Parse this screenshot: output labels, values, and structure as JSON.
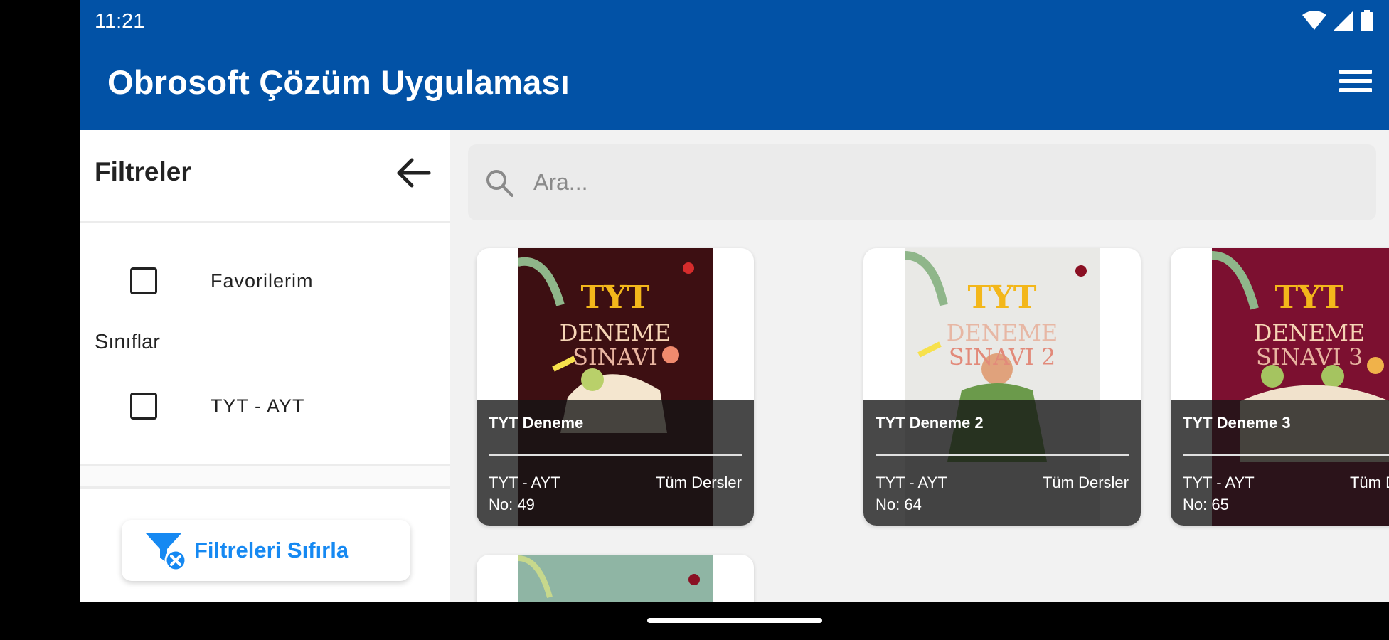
{
  "status_bar": {
    "time": "11:21"
  },
  "app_bar": {
    "title": "Obrosoft Çözüm Uygulaması"
  },
  "sidebar": {
    "title": "Filtreler",
    "favorites_label": "Favorilerim",
    "classes_section": "Sınıflar",
    "class_option": "TYT - AYT",
    "reset_button": "Filtreleri Sıfırla"
  },
  "search": {
    "placeholder": "Ara..."
  },
  "cards": [
    {
      "title": "TYT Deneme",
      "class": "TYT - AYT",
      "subject": "Tüm Dersler",
      "number": "No: 49",
      "cover": {
        "line1": "TYT",
        "line2": "DENEME",
        "line3": "SINAVI",
        "bg": "#3d0f12"
      }
    },
    {
      "title": "TYT Deneme 2",
      "class": "TYT - AYT",
      "subject": "Tüm Dersler",
      "number": "No: 64",
      "cover": {
        "line1": "TYT",
        "line2": "DENEME",
        "line3": "SINAVI 2",
        "bg": "#e9e9e6"
      }
    },
    {
      "title": "TYT Deneme 3",
      "class": "TYT - AYT",
      "subject": "Tüm Dersler",
      "number": "No: 65",
      "cover": {
        "line1": "TYT",
        "line2": "DENEME",
        "line3": "SINAVI 3",
        "bg": "#7c1030"
      }
    }
  ],
  "colors": {
    "app_bar": "#0252a6",
    "accent": "#1689f2"
  }
}
